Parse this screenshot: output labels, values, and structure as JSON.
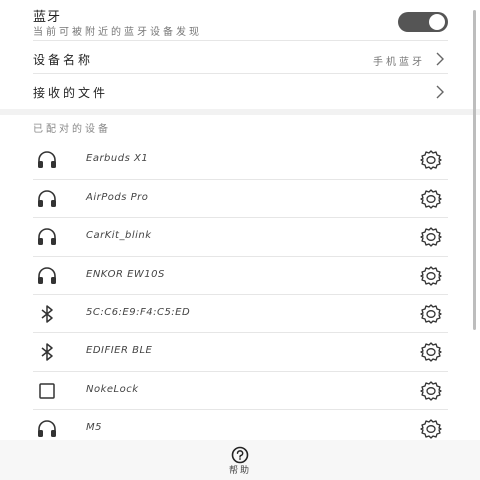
{
  "bluetooth": {
    "title": "蓝牙",
    "subtitle": "当前可被附近的蓝牙设备发现",
    "enabled": true
  },
  "settings": {
    "device_name_label": "设备名称",
    "device_name_value": "手机蓝牙",
    "received_files_label": "接收的文件"
  },
  "paired": {
    "header": "已配对的设备",
    "devices": [
      {
        "name": "Earbuds X1",
        "icon": "headset-icon"
      },
      {
        "name": "AirPods Pro",
        "icon": "headset-icon"
      },
      {
        "name": "CarKit_blink",
        "icon": "headset-icon"
      },
      {
        "name": "ENKOR EW10S",
        "icon": "headset-icon"
      },
      {
        "name": "5C:C6:E9:F4:C5:ED",
        "icon": "bluetooth-icon"
      },
      {
        "name": "EDIFIER BLE",
        "icon": "bluetooth-icon"
      },
      {
        "name": "NokeLock",
        "icon": "square-device-icon"
      },
      {
        "name": "M5",
        "icon": "headset-icon"
      }
    ]
  },
  "bottom": {
    "help_label": "帮助",
    "help_icon": "help-circle-icon"
  },
  "colors": {
    "toggle_on": "#555555",
    "divider": "#e6e6e6"
  }
}
